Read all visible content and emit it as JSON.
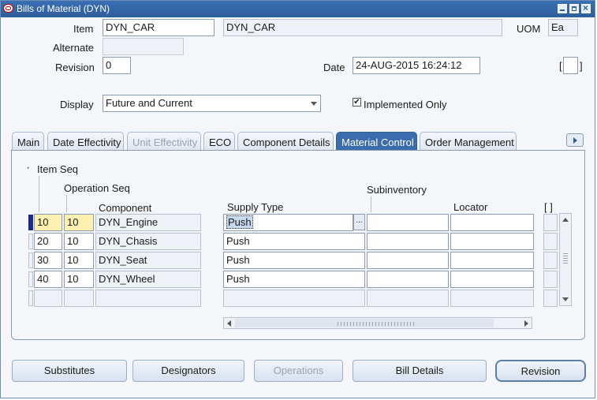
{
  "window": {
    "title": "Bills of Material (DYN)"
  },
  "header": {
    "item_label": "Item",
    "item_value": "DYN_CAR",
    "item_desc": "DYN_CAR",
    "uom_label": "UOM",
    "uom_value": "Ea",
    "alternate_label": "Alternate",
    "alternate_value": "",
    "revision_label": "Revision",
    "revision_value": "0",
    "date_label": "Date",
    "date_value": "24-AUG-2015 16:24:12",
    "attach_bracket": "[ ]",
    "display_label": "Display",
    "display_value": "Future and Current",
    "implemented_only_label": "Implemented Only",
    "implemented_only_checked": true
  },
  "tabs": [
    {
      "label": "Main",
      "state": "normal"
    },
    {
      "label": "Date Effectivity",
      "state": "normal"
    },
    {
      "label": "Unit Effectivity",
      "state": "disabled"
    },
    {
      "label": "ECO",
      "state": "normal"
    },
    {
      "label": "Component Details",
      "state": "normal"
    },
    {
      "label": "Material Control",
      "state": "active"
    },
    {
      "label": "Order Management",
      "state": "normal"
    }
  ],
  "grid": {
    "item_seq_header": "Item Seq",
    "operation_seq_header": "Operation Seq",
    "component_header": "Component",
    "supply_type_header": "Supply Type",
    "subinventory_header": "Subinventory",
    "locator_header": "Locator",
    "flag_header": "[ ]",
    "lov_button": "...",
    "rows": [
      {
        "item_seq": "10",
        "op_seq": "10",
        "component": "DYN_Engine",
        "supply_type": "Push",
        "subinventory": "",
        "locator": ""
      },
      {
        "item_seq": "20",
        "op_seq": "10",
        "component": "DYN_Chasis",
        "supply_type": "Push",
        "subinventory": "",
        "locator": ""
      },
      {
        "item_seq": "30",
        "op_seq": "10",
        "component": "DYN_Seat",
        "supply_type": "Push",
        "subinventory": "",
        "locator": ""
      },
      {
        "item_seq": "40",
        "op_seq": "10",
        "component": "DYN_Wheel",
        "supply_type": "Push",
        "subinventory": "",
        "locator": ""
      },
      {
        "item_seq": "",
        "op_seq": "",
        "component": "",
        "supply_type": "",
        "subinventory": "",
        "locator": ""
      }
    ]
  },
  "buttons": {
    "substitutes": "Substitutes",
    "designators": "Designators",
    "operations": "Operations",
    "bill_details": "Bill Details",
    "revision": "Revision"
  },
  "colors": {
    "title_bar": "#2d5e9e",
    "active_tab": "#3b6cae",
    "current_record": "#fdf0b0",
    "row_indicator": "#1a2b8c"
  }
}
